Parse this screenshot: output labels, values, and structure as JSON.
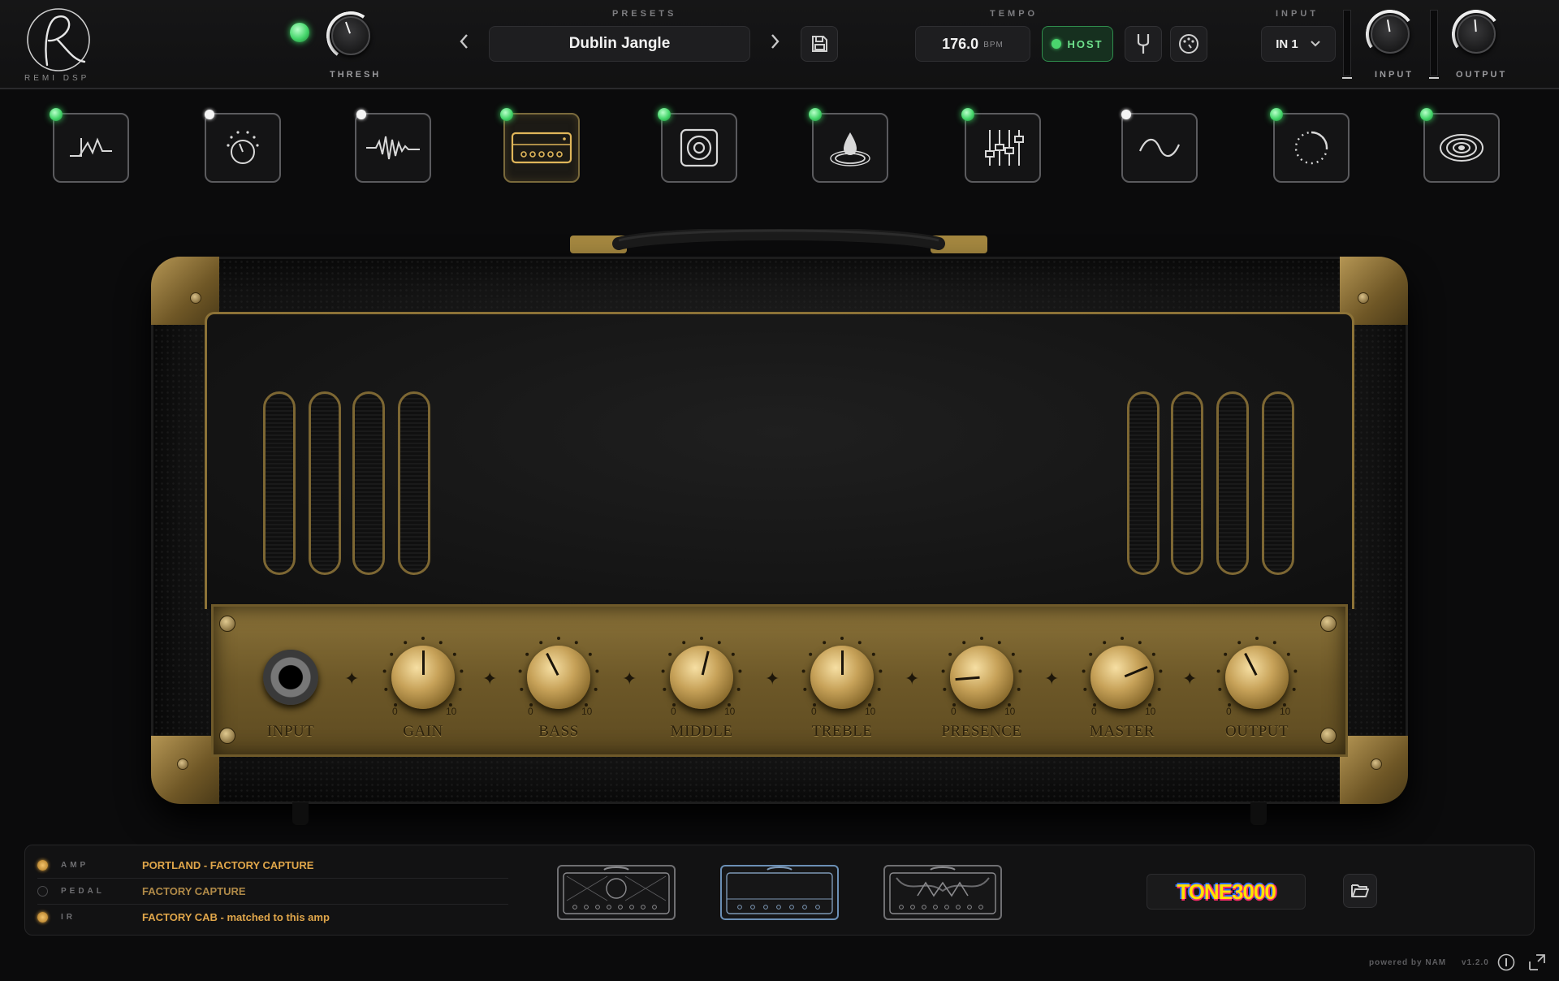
{
  "brand": {
    "logo_letter": "R",
    "name": "REMI DSP"
  },
  "gate": {
    "label": "THRESH",
    "enabled": true
  },
  "presets": {
    "section_label": "PRESETS",
    "current": "Dublin Jangle",
    "prev_icon": "chevron-left-icon",
    "next_icon": "chevron-right-icon",
    "save_icon": "save-icon"
  },
  "tempo": {
    "section_label": "TEMPO",
    "value": "176.0",
    "unit": "BPM",
    "host_label": "HOST",
    "host_enabled": true
  },
  "tools": {
    "tuner_icon": "tuning-fork-icon",
    "metronome_icon": "metronome-icon"
  },
  "io": {
    "section_label": "INPUT",
    "input_select": "IN 1",
    "input_label": "INPUT",
    "output_label": "OUTPUT"
  },
  "modules": [
    {
      "name": "noise-gate",
      "icon": "gate-icon",
      "led": "green",
      "active": false
    },
    {
      "name": "compressor",
      "icon": "dial-icon",
      "led": "white",
      "active": false
    },
    {
      "name": "pedal",
      "icon": "waveform-icon",
      "led": "white",
      "active": false
    },
    {
      "name": "amp",
      "icon": "amp-icon",
      "led": "green",
      "active": true
    },
    {
      "name": "cab",
      "icon": "speaker-icon",
      "led": "green",
      "active": false
    },
    {
      "name": "wet",
      "icon": "drop-icon",
      "led": "green",
      "active": false
    },
    {
      "name": "eq",
      "icon": "eq-sliders-icon",
      "led": "green",
      "active": false
    },
    {
      "name": "modulation",
      "icon": "sine-wave-icon",
      "led": "white",
      "active": false
    },
    {
      "name": "delay",
      "icon": "dotted-circle-icon",
      "led": "green",
      "active": false
    },
    {
      "name": "reverb",
      "icon": "ripple-icon",
      "led": "green",
      "active": false
    }
  ],
  "amp": {
    "input_label": "INPUT",
    "scale_min": "0",
    "scale_max": "10",
    "knobs": [
      {
        "label": "GAIN",
        "value": 5
      },
      {
        "label": "BASS",
        "value": 4
      },
      {
        "label": "MIDDLE",
        "value": 5.5
      },
      {
        "label": "TREBLE",
        "value": 5
      },
      {
        "label": "PRESENCE",
        "value": 1.5
      },
      {
        "label": "MASTER",
        "value": 7.5
      },
      {
        "label": "OUTPUT",
        "value": 4
      }
    ]
  },
  "captures": [
    {
      "tag": "AMP",
      "value": "PORTLAND - FACTORY CAPTURE",
      "led": "on"
    },
    {
      "tag": "PEDAL",
      "value": "FACTORY CAPTURE",
      "led": "off"
    },
    {
      "tag": "IR",
      "value": "FACTORY CAB - matched to this amp",
      "led": "on"
    }
  ],
  "tone_brand": "TONE3000",
  "footer": {
    "powered": "powered by NAM",
    "version": "v1.2.0"
  }
}
